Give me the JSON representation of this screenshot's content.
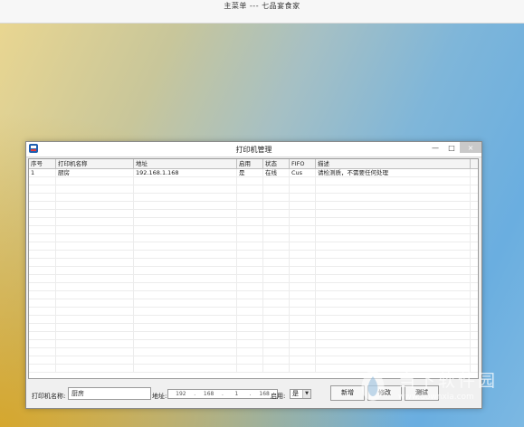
{
  "topbar": {
    "title": "主菜单  ---  七品宴食家"
  },
  "window": {
    "title": "打印机管理",
    "controls": {
      "minimize": "—",
      "restore": "□",
      "close": "×"
    }
  },
  "table": {
    "columns": [
      "序号",
      "打印机名称",
      "地址",
      "启用",
      "状态",
      "FIFO",
      "描述"
    ],
    "rows": [
      {
        "index": "1",
        "name": "厨房",
        "address": "192.168.1.168",
        "enabled": "是",
        "status": "在线",
        "fifo": "Cus",
        "desc": "请检测质，不需要任何处理"
      }
    ]
  },
  "form": {
    "name_label": "打印机名称:",
    "name_value": "厨房",
    "address_label": "地址:",
    "ip": [
      "192",
      "168",
      "1",
      "168"
    ],
    "enabled_label": "启用:",
    "enabled_value": "是",
    "add_button": "新增",
    "edit_button": "修改",
    "test_button": "测试"
  },
  "watermark": {
    "text": "当下软件园",
    "url": "www.downxia.com"
  }
}
